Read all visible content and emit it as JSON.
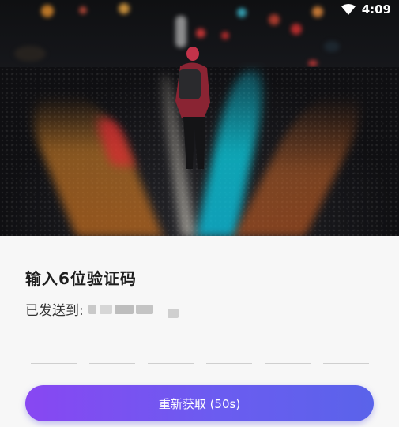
{
  "status_bar": {
    "time": "4:09",
    "icons": [
      "wifi-icon",
      "battery-icon"
    ]
  },
  "hero": {
    "image_subject": "person walking on wet road at night with neon reflections"
  },
  "verify": {
    "title": "输入6位验证码",
    "sent_to_label": "已发送到:",
    "phone_masked": true,
    "code_length": 6,
    "code_values": [
      "",
      "",
      "",
      "",
      "",
      ""
    ]
  },
  "resend_button": {
    "label": "重新获取 (50s)"
  },
  "colors": {
    "button_gradient_start": "#8847f2",
    "button_gradient_end": "#5a63ea",
    "background": "#f7f7f7"
  }
}
